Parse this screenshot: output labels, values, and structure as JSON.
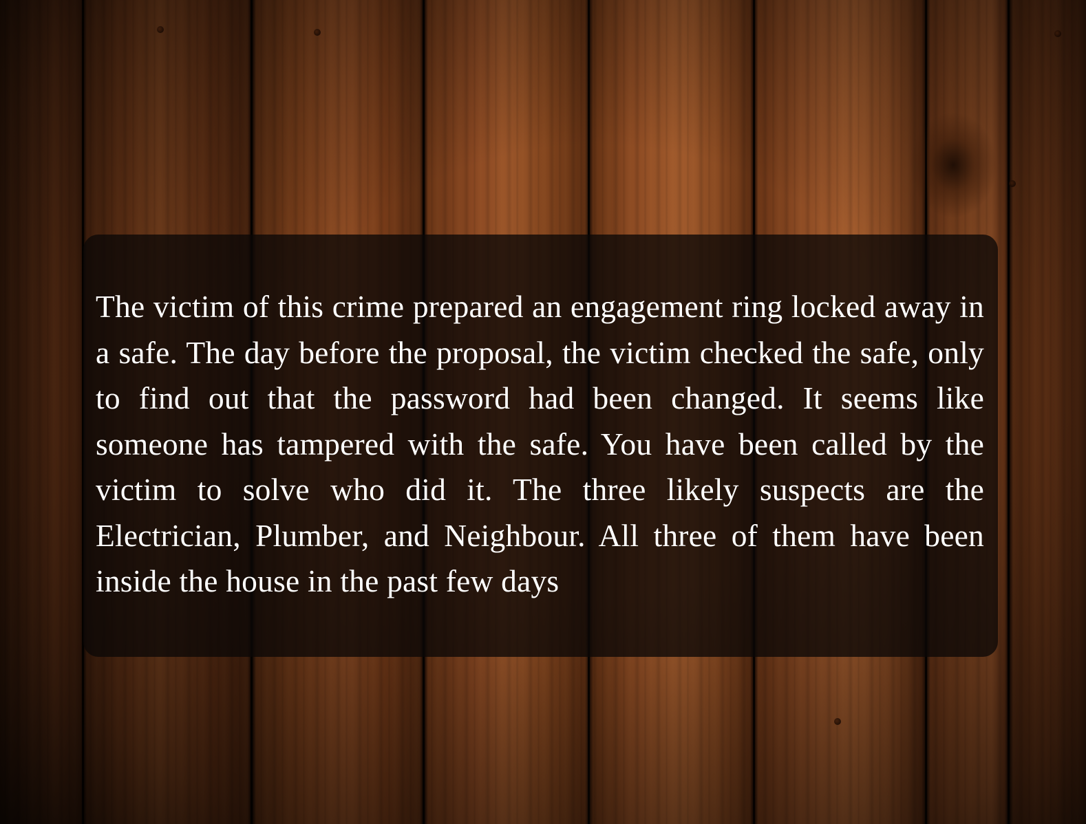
{
  "scene": {
    "background": "wood-planks",
    "panel_color": "#0c0806"
  },
  "story": {
    "text": "The victim of this crime prepared an engagement ring locked away in a safe. The day before the proposal, the victim checked the safe, only to find out that the password had been changed. It seems like someone has tampered with the safe. You have been called by the victim to solve who did it. The three likely suspects are the Electrician, Plumber, and Neighbour. All three of them have been inside the house in the past few days"
  }
}
